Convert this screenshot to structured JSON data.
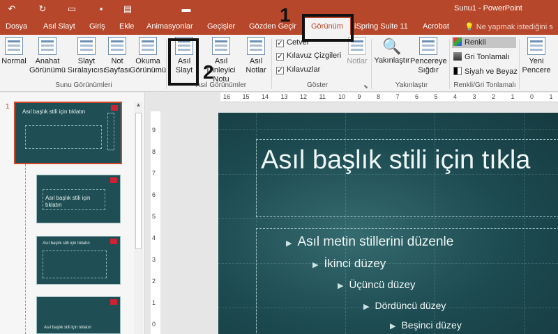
{
  "titlebar": {
    "title": "Sunu1 - PowerPoint"
  },
  "tabs": [
    "Dosya",
    "Asıl Slayt",
    "Giriş",
    "Ekle",
    "Animasyonlar",
    "Geçişler",
    "Gözden Geçir",
    "Görünüm",
    "iSpring Suite 11",
    "Acrobat"
  ],
  "tellme": "Ne yapmak istediğini s",
  "ribbon": {
    "sunu": {
      "label": "Sunu Görünümleri",
      "normal": "Normal",
      "anahat1": "Anahat",
      "anahat2": "Görünümü",
      "slayt1": "Slayt",
      "slayt2": "Sıralayıcısı",
      "not1": "Not",
      "not2": "Sayfası",
      "okuma1": "Okuma",
      "okuma2": "Görünümü"
    },
    "asil": {
      "label": "Asıl Görünümler",
      "slayt1": "Asıl",
      "slayt2": "Slayt",
      "dinleyici1": "Asıl Dinleyici",
      "dinleyici2": "Notu",
      "notlar1": "Asıl",
      "notlar2": "Notlar"
    },
    "goster": {
      "label": "Göster",
      "cetvel": "Cetvel",
      "kilavuz_cizgileri": "Kılavuz Çizgileri",
      "kilavuzlar": "Kılavuzlar",
      "notlar": "Notlar"
    },
    "yakinlastir": {
      "label": "Yakınlaştır",
      "yakin": "Yakınlaştır",
      "pencere1": "Pencereye",
      "pencere2": "Sığdır"
    },
    "renk": {
      "label": "Renkli/Gri Tonlamalı",
      "renkli": "Renkli",
      "gri": "Gri Tonlamalı",
      "siyah": "Siyah ve Beyaz"
    },
    "pencere": {
      "yeni1": "Yeni",
      "yeni2": "Pencere"
    }
  },
  "annotations": {
    "one": "1",
    "two": "2"
  },
  "thumbnails": {
    "num": "1",
    "t1": "Asıl başlık stili için tıklatın",
    "t2a": "Asıl başlık stili için",
    "t2b": "tıklatın",
    "t3": "Asıl başlık stili için tıklatın",
    "t4": "Asıl başlık stili için tıklatın"
  },
  "hruler": [
    "16",
    "15",
    "14",
    "13",
    "12",
    "11",
    "10",
    "9",
    "8",
    "7",
    "6",
    "5",
    "4",
    "3",
    "2",
    "1",
    "0",
    "1"
  ],
  "vruler": [
    "9",
    "8",
    "7",
    "6",
    "5",
    "4",
    "3",
    "2",
    "1",
    "0"
  ],
  "slide": {
    "title": "Asıl başlık stili için tıkla",
    "levels": [
      "Asıl metin stillerini düzenle",
      "İkinci düzey",
      "Üçüncü düzey",
      "Dördüncü düzey",
      "Beşinci düzey"
    ]
  },
  "colors": {
    "accent": "#b7472a",
    "slide_bg": "#1f4f55"
  }
}
